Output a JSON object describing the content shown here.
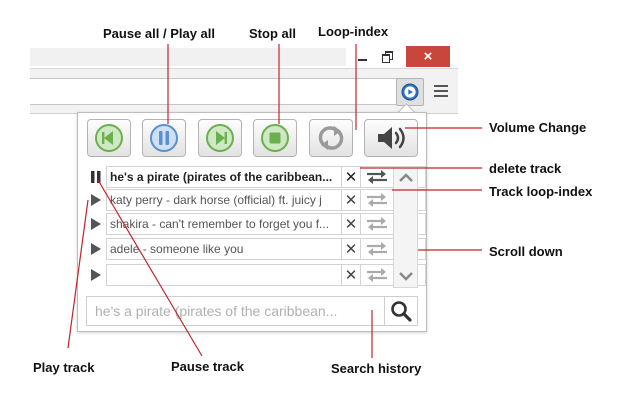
{
  "colors": {
    "accent_green": "#6ab04c",
    "accent_blue": "#5b8fd1",
    "close_red": "#c9463d",
    "annotation_line": "#c0262b"
  },
  "window_controls": {
    "minimize_icon": "minimize-icon",
    "maximize_icon": "restore-icon",
    "close_label": "×"
  },
  "toolbar": {
    "bookmark_icon": "☆",
    "extension_icon": "player-extension-icon",
    "menu_icon": "hamburger-menu-icon"
  },
  "controls": [
    {
      "name": "previous-button",
      "icon": "previous-icon"
    },
    {
      "name": "pause-all-button",
      "icon": "pause-icon"
    },
    {
      "name": "next-button",
      "icon": "next-icon"
    },
    {
      "name": "stop-all-button",
      "icon": "stop-icon"
    },
    {
      "name": "loop-index-button",
      "icon": "loop-icon"
    },
    {
      "name": "volume-button",
      "icon": "speaker-icon"
    }
  ],
  "tracks": [
    {
      "title": "he's a pirate (pirates of the caribbean...",
      "playing": true
    },
    {
      "title": "katy perry - dark horse (official) ft. juicy j",
      "playing": false
    },
    {
      "title": "shakira - can't remember to forget you f...",
      "playing": false
    },
    {
      "title": "adele - someone like you",
      "playing": false
    },
    {
      "title": "",
      "playing": false
    }
  ],
  "track_actions": {
    "delete_label": "✕"
  },
  "search": {
    "placeholder": "he's a pirate (pirates of the caribbean..."
  },
  "annotations": {
    "pause_all": "Pause all / Play all",
    "stop_all": "Stop all",
    "loop_index": "Loop-index",
    "volume_change": "Volume Change",
    "delete_track": "delete track",
    "track_loop_index": "Track loop-index",
    "scroll_down": "Scroll down",
    "play_track": "Play track",
    "pause_track": "Pause track",
    "search_history": "Search history"
  }
}
